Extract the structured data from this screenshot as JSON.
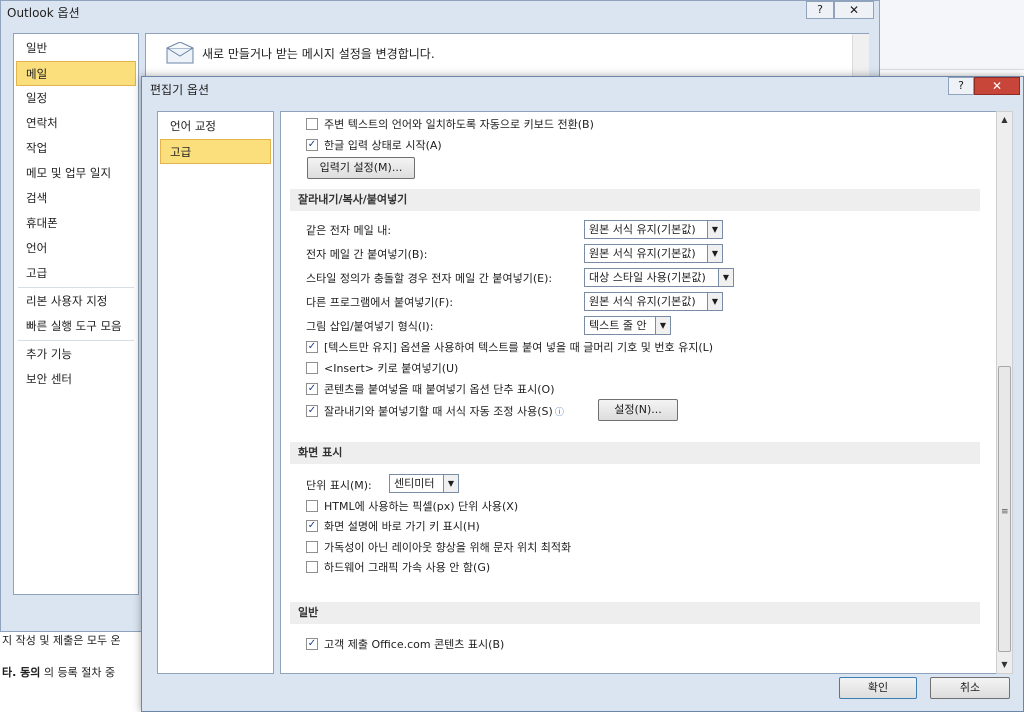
{
  "background": {
    "text1": "지 작성 및 제출은 모두 온",
    "text2_bold": "타. 동의",
    "text2_rest": " 의 등록 절차 중"
  },
  "outlook_options": {
    "title": "Outlook 옵션",
    "help": "?",
    "close": "✕",
    "nav": [
      "일반",
      "메일",
      "일정",
      "연락처",
      "작업",
      "메모 및 업무 일지",
      "검색",
      "휴대폰",
      "언어",
      "고급",
      "리본 사용자 지정",
      "빠른 실행 도구 모음",
      "추가 기능",
      "보안 센터"
    ],
    "selected": "메일",
    "header_text": "새로 만들거나 받는 메시지 설정을 변경합니다."
  },
  "editor_options": {
    "title": "편집기 옵션",
    "help": "?",
    "close": "✕",
    "nav": [
      "언어 교정",
      "고급"
    ],
    "selected": "고급",
    "top_options": [
      {
        "label": "주변 텍스트의 언어와 일치하도록 자동으로 키보드 전환(B)",
        "checked": false
      },
      {
        "label": "한글 입력 상태로 시작(A)",
        "checked": true
      }
    ],
    "ime_button": "입력기 설정(M)...",
    "section_cut_copy": "잘라내기/복사/붙여넣기",
    "paste_rows": [
      {
        "label": "같은 전자 메일 내:",
        "value": "원본 서식 유지(기본값)"
      },
      {
        "label": "전자 메일 간 붙여넣기(B):",
        "value": "원본 서식 유지(기본값)"
      },
      {
        "label": "스타일 정의가 충돌할 경우 전자 메일 간 붙여넣기(E):",
        "value": "대상 스타일 사용(기본값)"
      },
      {
        "label": "다른 프로그램에서 붙여넣기(F):",
        "value": "원본 서식 유지(기본값)"
      },
      {
        "label": "그림 삽입/붙여넣기 형식(I):",
        "value": "텍스트 줄 안"
      }
    ],
    "paste_checks": [
      {
        "label": "[텍스트만 유지] 옵션을 사용하여 텍스트를 붙여 넣을 때 글머리 기호 및 번호 유지(L)",
        "checked": true
      },
      {
        "label": "<Insert> 키로 붙여넣기(U)",
        "checked": false
      },
      {
        "label": "콘텐츠를 붙여넣을 때 붙여넣기 옵션 단추 표시(O)",
        "checked": true
      },
      {
        "label": "잘라내기와 붙여넣기할 때 서식 자동 조정 사용(S)",
        "checked": true
      }
    ],
    "settings_button": "설정(N)...",
    "section_display": "화면 표시",
    "unit_label": "단위 표시(M):",
    "unit_value": "센티미터",
    "display_checks": [
      {
        "label": "HTML에 사용하는 픽셀(px) 단위 사용(X)",
        "checked": false
      },
      {
        "label": "화면 설명에 바로 가기 키 표시(H)",
        "checked": true
      },
      {
        "label": "가독성이 아닌 레이아웃 향상을 위해 문자 위치 최적화",
        "checked": false
      },
      {
        "label": "하드웨어 그래픽 가속 사용 안 함(G)",
        "checked": false
      }
    ],
    "section_general": "일반",
    "general_checks": [
      {
        "label": "고객 제출 Office.com 콘텐츠 표시(B)",
        "checked": true
      }
    ],
    "ok": "확인",
    "cancel": "취소"
  }
}
